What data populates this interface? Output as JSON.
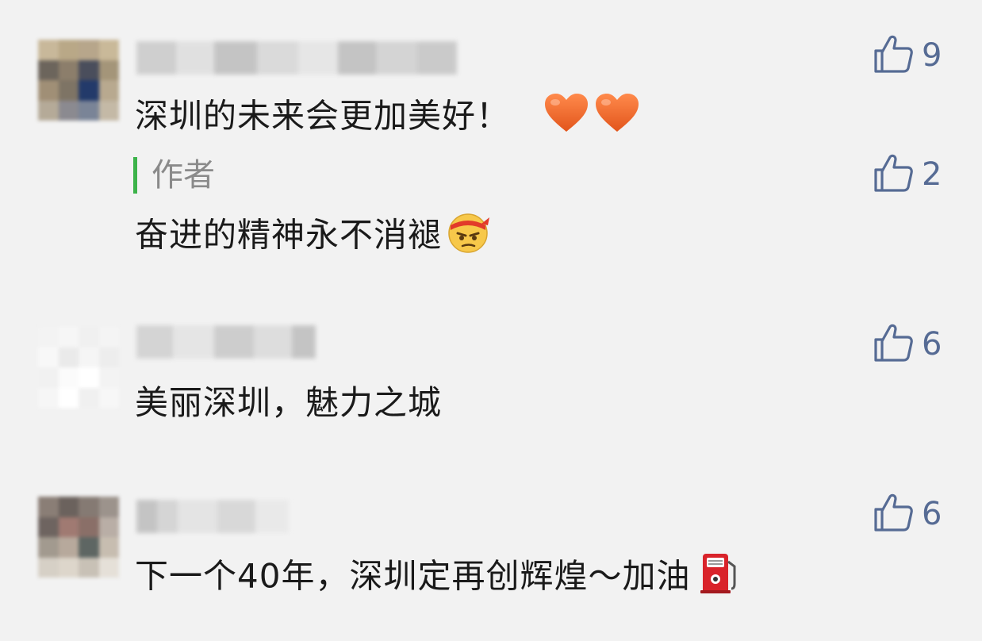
{
  "comments": [
    {
      "text": "深圳的未来会更加美好！",
      "likes": "9",
      "emoji": [
        "heart-icon",
        "heart-icon"
      ],
      "reply": {
        "label": "作者",
        "text": "奋进的精神永不消褪",
        "likes": "2",
        "emoji": "determined-face-icon"
      }
    },
    {
      "text": "美丽深圳，魅力之城",
      "likes": "6"
    },
    {
      "text": "下一个40年，深圳定再创辉煌～加油",
      "likes": "6",
      "emoji": "fuel-pump-icon"
    }
  ],
  "colors": {
    "background": "#f2f2f2",
    "like_blue": "#566b94",
    "author_bar": "#3cb34a",
    "heart": "#f26a2c"
  }
}
